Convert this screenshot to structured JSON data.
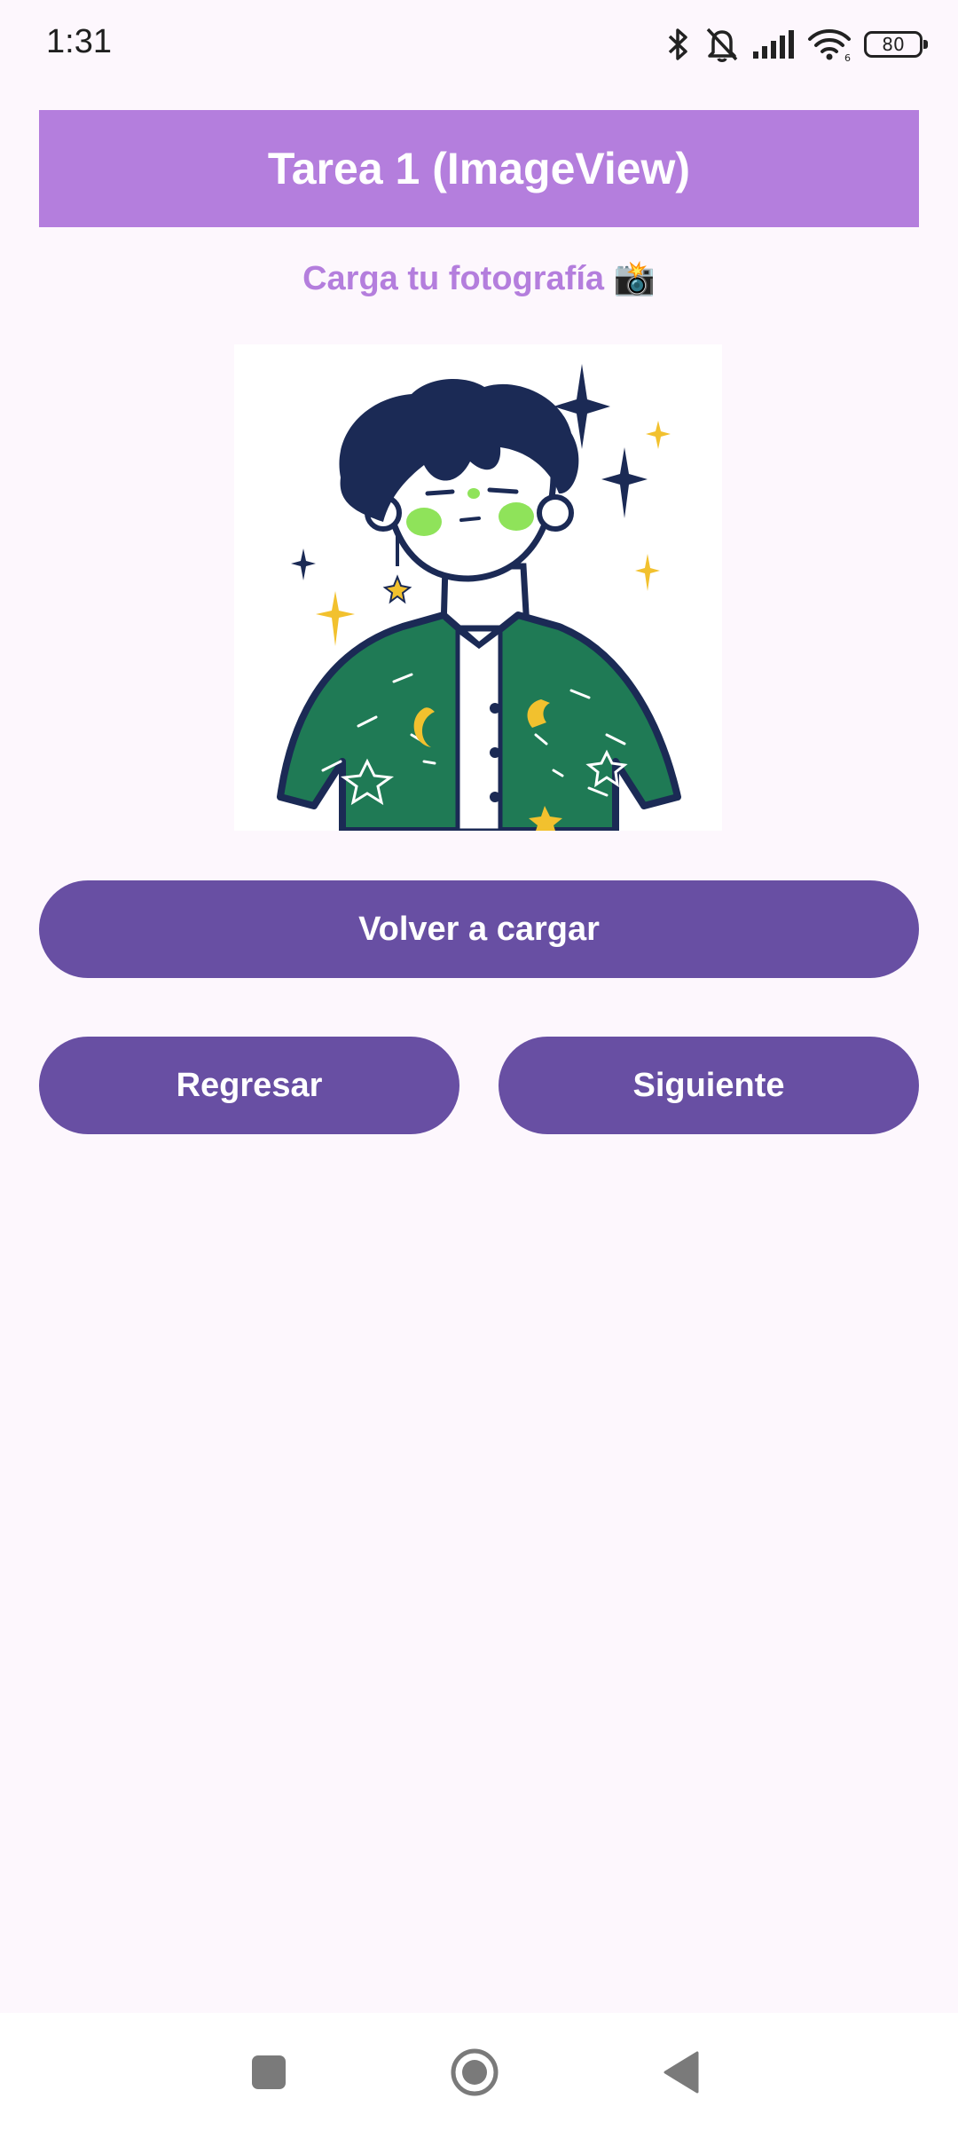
{
  "status_bar": {
    "time": "1:31",
    "battery_level": "80",
    "icons": [
      "bluetooth-icon",
      "bell-off-icon",
      "cell-signal-icon",
      "wifi-icon",
      "battery-icon"
    ]
  },
  "app": {
    "title": "Tarea 1 (ImageView)",
    "subtitle": "Carga tu fotografía 📸",
    "accent_color": "#B47EDD",
    "button_color": "#684FA3",
    "background_color": "#FDF7FD"
  },
  "buttons": {
    "reload_label": "Volver a cargar",
    "back_label": "Regresar",
    "next_label": "Siguiente"
  },
  "navigation": {
    "items": [
      "recents-icon",
      "home-icon",
      "back-icon"
    ]
  }
}
